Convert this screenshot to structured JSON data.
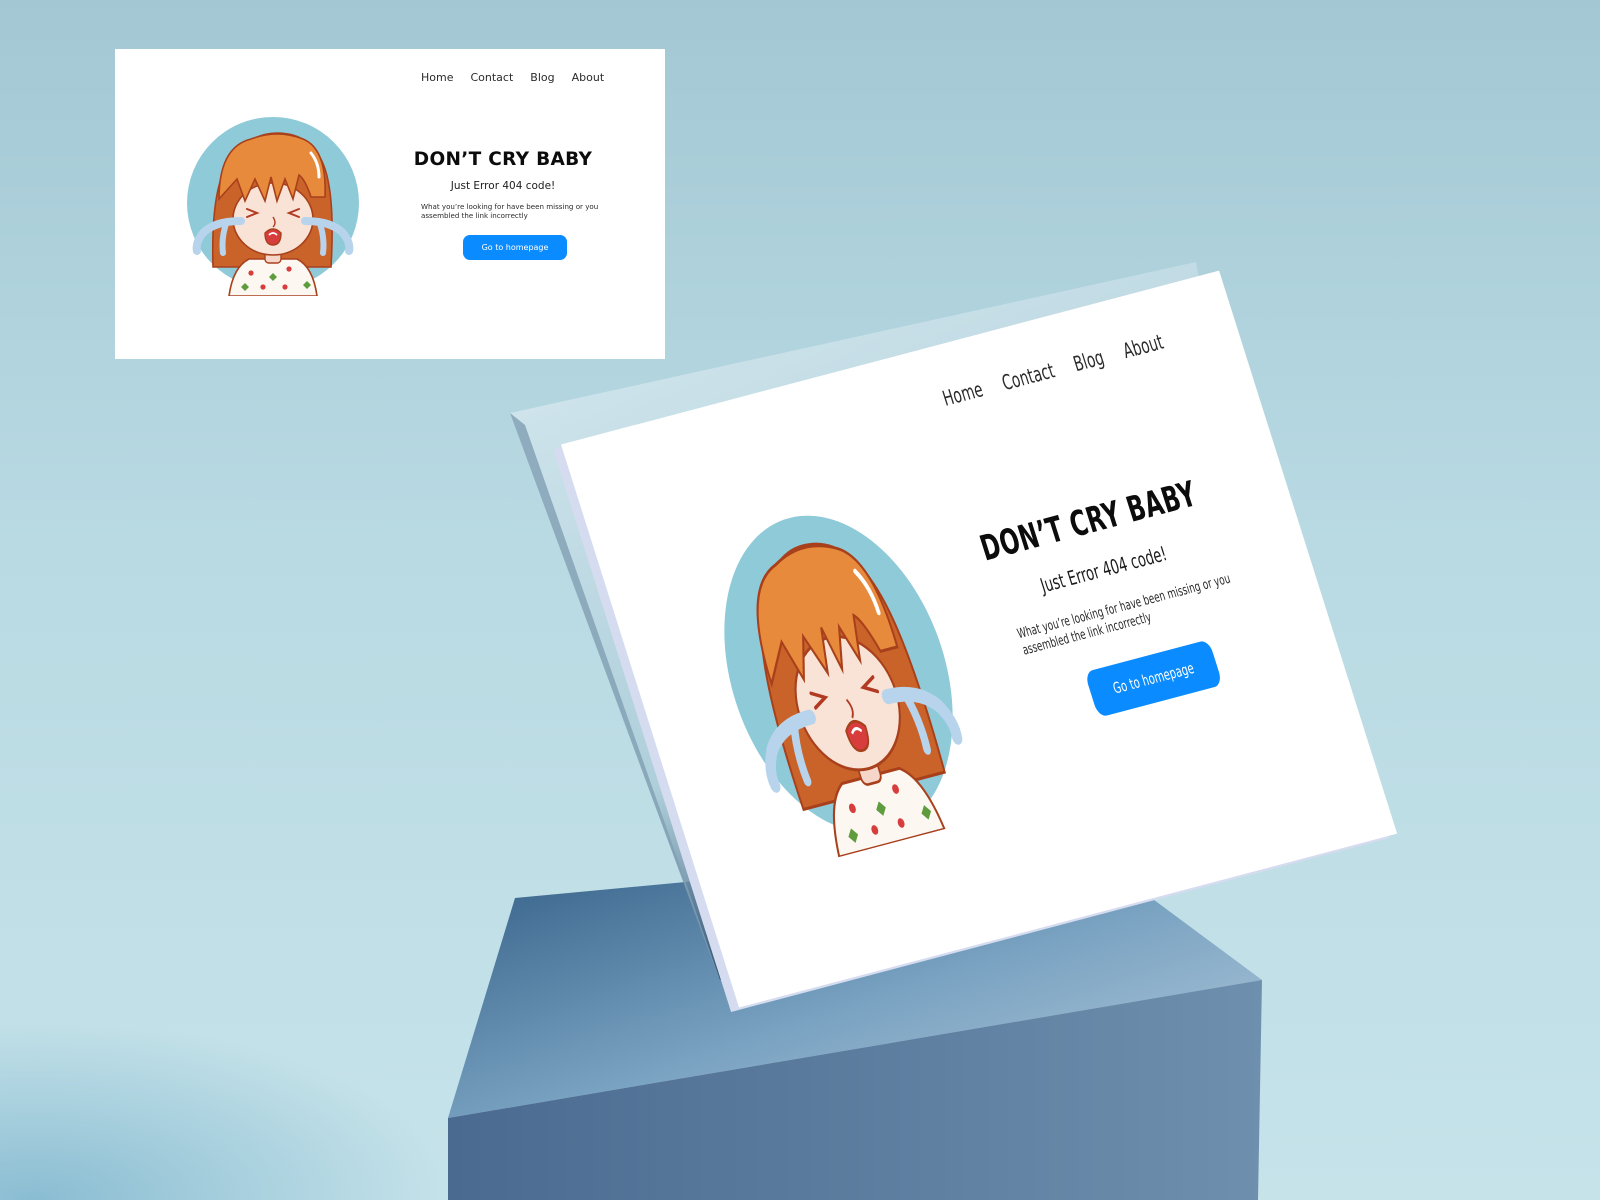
{
  "nav": {
    "items": [
      "Home",
      "Contact",
      "Blog",
      "About"
    ]
  },
  "hero": {
    "headline": "DON’T CRY BABY",
    "subhead": "Just Error 404 code!",
    "description": "What you’re looking for have been missing or you assembled the link incorrectly",
    "cta_label": "Go to homepage"
  },
  "illustration": {
    "icon": "crying-girl-illustration"
  },
  "colors": {
    "accent": "#0a8bff",
    "avatar_circle": "#8fcad9",
    "hair": "#e88a3b",
    "background": "#b9dae3",
    "pedestal": "#5a7fa3"
  }
}
